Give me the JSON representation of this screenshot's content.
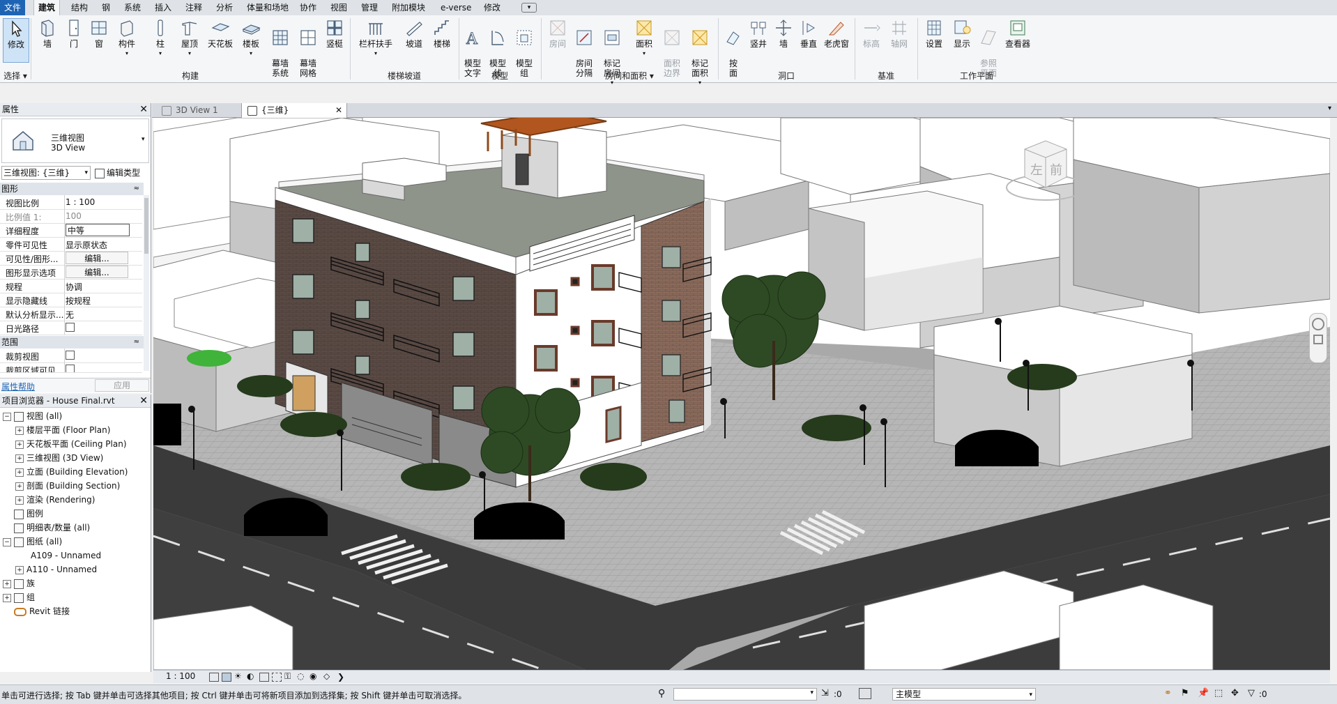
{
  "menu_tabs": [
    "文件",
    "建筑",
    "结构",
    "钢",
    "系统",
    "插入",
    "注释",
    "分析",
    "体量和场地",
    "协作",
    "视图",
    "管理",
    "附加模块",
    "e-verse",
    "修改"
  ],
  "ribbon": {
    "buttons": [
      {
        "label": "修改",
        "icon": "cursor-icon"
      },
      {
        "label": "墙",
        "icon": "wall-icon"
      },
      {
        "label": "门",
        "icon": "door-icon"
      },
      {
        "label": "窗",
        "icon": "window-icon"
      },
      {
        "label": "构件",
        "icon": "component-icon"
      },
      {
        "label": "柱",
        "icon": "column-icon"
      },
      {
        "label": "屋顶",
        "icon": "roof-icon"
      },
      {
        "label": "天花板",
        "icon": "ceiling-icon"
      },
      {
        "label": "楼板",
        "icon": "floor-icon"
      },
      {
        "label": "幕墙\n系统",
        "icon": "curtain-system-icon"
      },
      {
        "label": "幕墙\n网格",
        "icon": "curtain-grid-icon"
      },
      {
        "label": "竖梃",
        "icon": "mullion-icon"
      },
      {
        "label": "栏杆扶手",
        "icon": "railing-icon"
      },
      {
        "label": "坡道",
        "icon": "ramp-icon"
      },
      {
        "label": "楼梯",
        "icon": "stair-icon"
      },
      {
        "label": "模型\n文字",
        "icon": "model-text-icon"
      },
      {
        "label": "模型\n线",
        "icon": "model-line-icon"
      },
      {
        "label": "模型\n组",
        "icon": "model-group-icon"
      },
      {
        "label": "房间",
        "icon": "room-icon"
      },
      {
        "label": "房间\n分隔",
        "icon": "room-separator-icon"
      },
      {
        "label": "标记\n房间",
        "icon": "tag-room-icon"
      },
      {
        "label": "面积",
        "icon": "area-icon"
      },
      {
        "label": "面积\n边界",
        "icon": "area-boundary-icon"
      },
      {
        "label": "标记\n面积",
        "icon": "tag-area-icon"
      },
      {
        "label": "按\n面",
        "icon": "by-face-icon"
      },
      {
        "label": "竖井",
        "icon": "shaft-icon"
      },
      {
        "label": "墙",
        "icon": "wall-opening-icon"
      },
      {
        "label": "垂直",
        "icon": "vertical-icon"
      },
      {
        "label": "老虎窗",
        "icon": "dormer-icon"
      },
      {
        "label": "标高",
        "icon": "level-icon"
      },
      {
        "label": "轴网",
        "icon": "grid-icon"
      },
      {
        "label": "设置",
        "icon": "set-icon"
      },
      {
        "label": "显示",
        "icon": "show-icon"
      },
      {
        "label": "参照\n平面",
        "icon": "ref-plane-icon"
      },
      {
        "label": "查看器",
        "icon": "viewer-icon"
      }
    ],
    "groups": [
      "选择",
      "构建",
      "楼梯坡道",
      "模型",
      "房间和面积",
      "洞口",
      "基准",
      "工作平面"
    ]
  },
  "properties": {
    "title": "属性",
    "type_name": "三维视图",
    "type_name_en": "3D View",
    "view_selector": "三维视图: {三维}",
    "edit_type": "编辑类型",
    "cat_graphics": "图形",
    "cat_extents": "范围",
    "rows": [
      {
        "k": "视图比例",
        "v": "1 : 100"
      },
      {
        "k": "比例值 1:",
        "v": "100"
      },
      {
        "k": "详细程度",
        "v": "中等"
      },
      {
        "k": "零件可见性",
        "v": "显示原状态"
      },
      {
        "k": "可见性/图形...",
        "v": "编辑..."
      },
      {
        "k": "图形显示选项",
        "v": "编辑..."
      },
      {
        "k": "规程",
        "v": "协调"
      },
      {
        "k": "显示隐藏线",
        "v": "按规程"
      },
      {
        "k": "默认分析显示...",
        "v": "无"
      },
      {
        "k": "日光路径",
        "v": ""
      }
    ],
    "extent_rows": [
      {
        "k": "裁剪视图",
        "v": ""
      },
      {
        "k": "裁剪区域可见",
        "v": ""
      }
    ],
    "help": "属性帮助",
    "apply": "应用"
  },
  "browser": {
    "title": "项目浏览器 - House Final.rvt",
    "nodes": [
      {
        "label": "视图 (all)",
        "level": 0,
        "tog": "−"
      },
      {
        "label": "楼层平面 (Floor Plan)",
        "level": 1,
        "tog": "+"
      },
      {
        "label": "天花板平面 (Ceiling Plan)",
        "level": 1,
        "tog": "+"
      },
      {
        "label": "三维视图 (3D View)",
        "level": 1,
        "tog": "+"
      },
      {
        "label": "立面 (Building Elevation)",
        "level": 1,
        "tog": "+"
      },
      {
        "label": "剖面 (Building Section)",
        "level": 1,
        "tog": "+"
      },
      {
        "label": "渲染 (Rendering)",
        "level": 1,
        "tog": "+"
      },
      {
        "label": "图例",
        "level": 0,
        "tog": ""
      },
      {
        "label": "明细表/数量 (all)",
        "level": 0,
        "tog": ""
      },
      {
        "label": "图纸 (all)",
        "level": 0,
        "tog": "−"
      },
      {
        "label": "A109 - Unnamed",
        "level": 1,
        "tog": ""
      },
      {
        "label": "A110 - Unnamed",
        "level": 1,
        "tog": "+"
      },
      {
        "label": "族",
        "level": 0,
        "tog": "+"
      },
      {
        "label": "组",
        "level": 0,
        "tog": "+"
      },
      {
        "label": "Revit 链接",
        "level": 0,
        "tog": ""
      }
    ]
  },
  "view_tabs": [
    {
      "label": "3D View 1"
    },
    {
      "label": "{三维}"
    }
  ],
  "viewcube": {
    "left": "左",
    "front": "前"
  },
  "view_bar": {
    "scale": "1 : 100"
  },
  "status": {
    "message": "单击可进行选择; 按 Tab 键并单击可选择其他项目; 按 Ctrl 键并单击可将新项目添加到选择集; 按 Shift 键并单击可取消选择。",
    "coord": ":0",
    "model": "主模型",
    "filter": ":0"
  },
  "colors": {
    "file_tab": "#1e64b4",
    "brick": "#5a4a44",
    "terracotta": "#b07a5a",
    "road": "#3a3a3a",
    "pavement": "#b9b9b9",
    "tree": "#2e4a24"
  }
}
